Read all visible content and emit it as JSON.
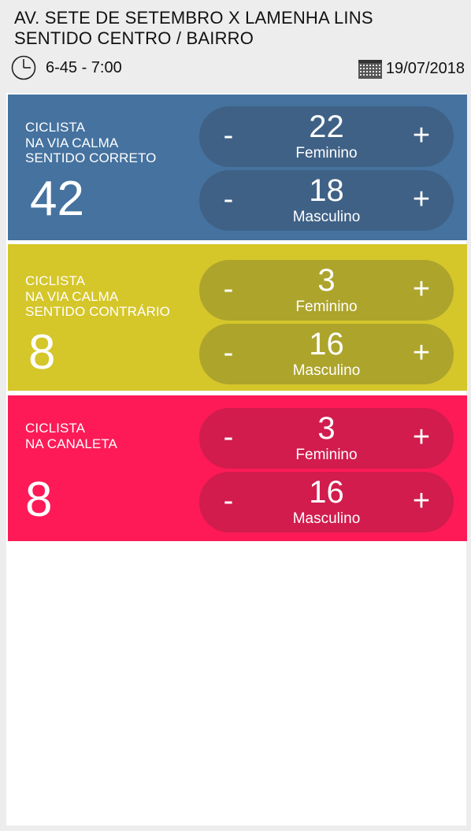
{
  "header": {
    "title_line1": "AV. SETE DE SETEMBRO X LAMENHA LINS",
    "title_line2": "SENTIDO CENTRO / BAIRRO",
    "time_range": "6-45 - 7:00",
    "date": "19/07/2018",
    "clock_icon": "clock-icon",
    "calendar_icon": "calendar-icon"
  },
  "panels": [
    {
      "label_line1": "CICLISTA",
      "label_line2": "NA VIA CALMA",
      "label_line3": "SENTIDO CORRETO",
      "total": "42",
      "color": "#45729f",
      "counter_color": "#3f6186",
      "counters": [
        {
          "value": "22",
          "label": "Feminino",
          "minus": "-",
          "plus": "+"
        },
        {
          "value": "18",
          "label": "Masculino",
          "minus": "-",
          "plus": "+"
        }
      ]
    },
    {
      "label_line1": "CICLISTA",
      "label_line2": "NA VIA CALMA",
      "label_line3": "SENTIDO CONTRÁRIO",
      "total": "8",
      "color": "#d5c62a",
      "counter_color": "#ada42c",
      "counters": [
        {
          "value": "3",
          "label": "Feminino",
          "minus": "-",
          "plus": "+"
        },
        {
          "value": "16",
          "label": "Masculino",
          "minus": "-",
          "plus": "+"
        }
      ]
    },
    {
      "label_line1": "CICLISTA",
      "label_line2": "NA CANALETA",
      "label_line3": "",
      "total": "8",
      "color": "#fd1a57",
      "counter_color": "#d11c4d",
      "counters": [
        {
          "value": "3",
          "label": "Feminino",
          "minus": "-",
          "plus": "+"
        },
        {
          "value": "16",
          "label": "Masculino",
          "minus": "-",
          "plus": "+"
        }
      ]
    }
  ]
}
